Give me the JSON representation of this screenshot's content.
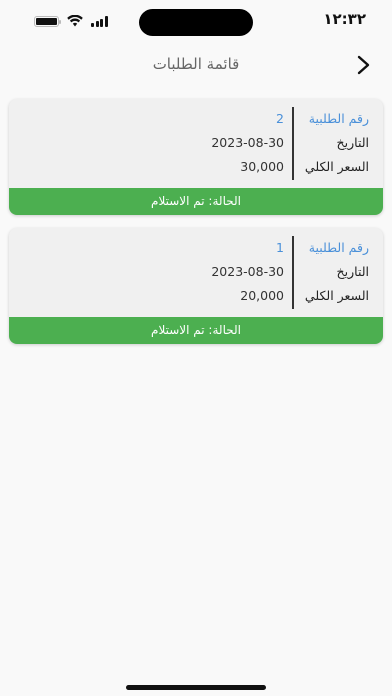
{
  "status_bar": {
    "time": "١٢:٣٢"
  },
  "header": {
    "title": "قائمة الطلبات"
  },
  "labels": {
    "order_number": "رقم الطلبية",
    "date": "التاريخ",
    "total": "السعر الكلي"
  },
  "orders": [
    {
      "number": "2",
      "date": "2023-08-30",
      "total": "30,000",
      "status": "الحالة: تم الاستلام"
    },
    {
      "number": "1",
      "date": "2023-08-30",
      "total": "20,000",
      "status": "الحالة: تم الاستلام"
    }
  ],
  "colors": {
    "accent_blue": "#4a90d9",
    "status_green": "#4caf50"
  }
}
